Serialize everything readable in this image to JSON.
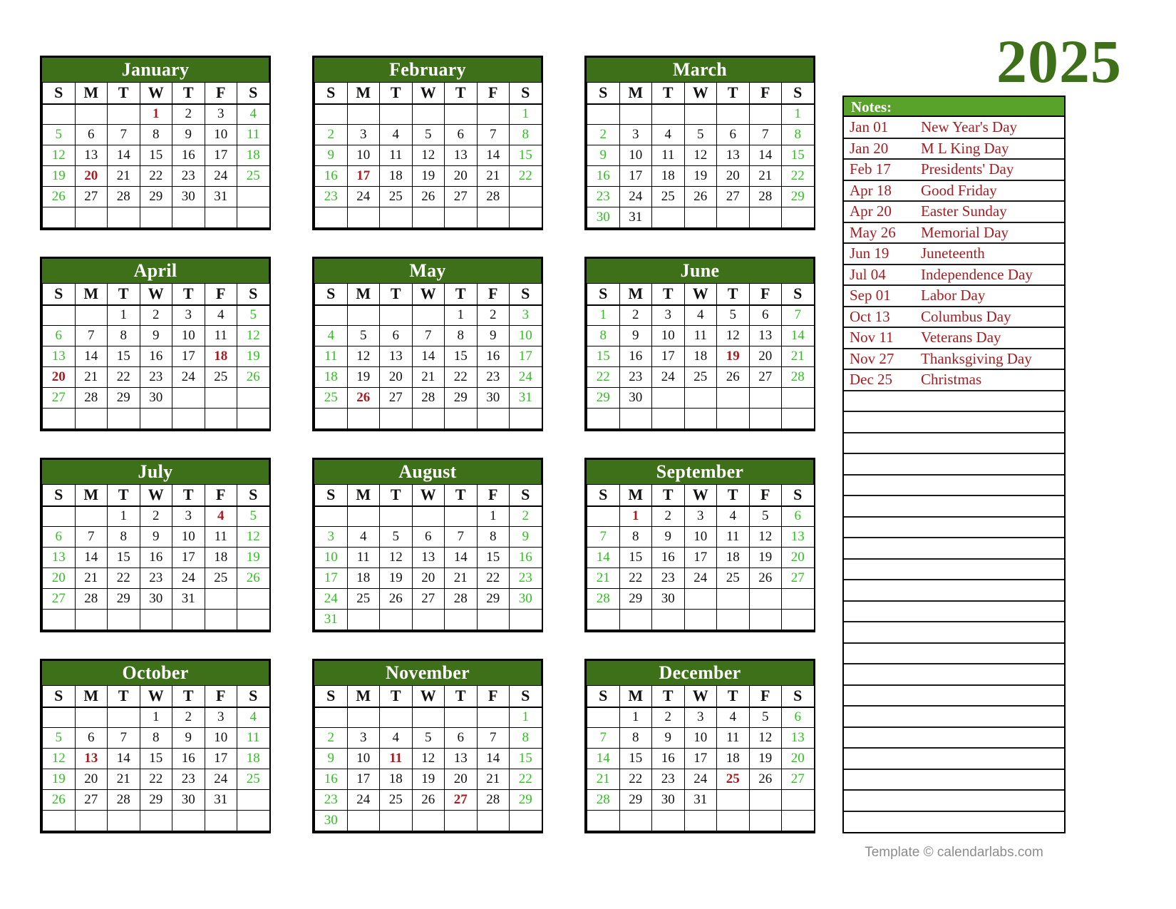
{
  "year_title": "2025",
  "colors": {
    "month_header_green": "#3d7019",
    "notes_header_green": "#5aa32a",
    "weekend_green": "#2fc21f",
    "holiday_red": "#a61c20",
    "footer_gray": "#8c8c8c"
  },
  "weekday_headers": [
    "S",
    "M",
    "T",
    "W",
    "T",
    "F",
    "S"
  ],
  "months": [
    {
      "name": "January",
      "weeks": [
        [
          "",
          "",
          "",
          "1",
          "2",
          "3",
          "4"
        ],
        [
          "5",
          "6",
          "7",
          "8",
          "9",
          "10",
          "11"
        ],
        [
          "12",
          "13",
          "14",
          "15",
          "16",
          "17",
          "18"
        ],
        [
          "19",
          "20",
          "21",
          "22",
          "23",
          "24",
          "25"
        ],
        [
          "26",
          "27",
          "28",
          "29",
          "30",
          "31",
          ""
        ],
        [
          "",
          "",
          "",
          "",
          "",
          "",
          ""
        ]
      ],
      "holidays": [
        "1",
        "20"
      ]
    },
    {
      "name": "February",
      "weeks": [
        [
          "",
          "",
          "",
          "",
          "",
          "",
          "1"
        ],
        [
          "2",
          "3",
          "4",
          "5",
          "6",
          "7",
          "8"
        ],
        [
          "9",
          "10",
          "11",
          "12",
          "13",
          "14",
          "15"
        ],
        [
          "16",
          "17",
          "18",
          "19",
          "20",
          "21",
          "22"
        ],
        [
          "23",
          "24",
          "25",
          "26",
          "27",
          "28",
          ""
        ],
        [
          "",
          "",
          "",
          "",
          "",
          "",
          ""
        ]
      ],
      "holidays": [
        "17"
      ]
    },
    {
      "name": "March",
      "weeks": [
        [
          "",
          "",
          "",
          "",
          "",
          "",
          "1"
        ],
        [
          "2",
          "3",
          "4",
          "5",
          "6",
          "7",
          "8"
        ],
        [
          "9",
          "10",
          "11",
          "12",
          "13",
          "14",
          "15"
        ],
        [
          "16",
          "17",
          "18",
          "19",
          "20",
          "21",
          "22"
        ],
        [
          "23",
          "24",
          "25",
          "26",
          "27",
          "28",
          "29"
        ],
        [
          "30",
          "31",
          "",
          "",
          "",
          "",
          ""
        ]
      ],
      "holidays": []
    },
    {
      "name": "April",
      "weeks": [
        [
          "",
          "",
          "1",
          "2",
          "3",
          "4",
          "5"
        ],
        [
          "6",
          "7",
          "8",
          "9",
          "10",
          "11",
          "12"
        ],
        [
          "13",
          "14",
          "15",
          "16",
          "17",
          "18",
          "19"
        ],
        [
          "20",
          "21",
          "22",
          "23",
          "24",
          "25",
          "26"
        ],
        [
          "27",
          "28",
          "29",
          "30",
          "",
          "",
          ""
        ],
        [
          "",
          "",
          "",
          "",
          "",
          "",
          ""
        ]
      ],
      "holidays": [
        "18",
        "20"
      ]
    },
    {
      "name": "May",
      "weeks": [
        [
          "",
          "",
          "",
          "",
          "1",
          "2",
          "3"
        ],
        [
          "4",
          "5",
          "6",
          "7",
          "8",
          "9",
          "10"
        ],
        [
          "11",
          "12",
          "13",
          "14",
          "15",
          "16",
          "17"
        ],
        [
          "18",
          "19",
          "20",
          "21",
          "22",
          "23",
          "24"
        ],
        [
          "25",
          "26",
          "27",
          "28",
          "29",
          "30",
          "31"
        ],
        [
          "",
          "",
          "",
          "",
          "",
          "",
          ""
        ]
      ],
      "holidays": [
        "26"
      ]
    },
    {
      "name": "June",
      "weeks": [
        [
          "1",
          "2",
          "3",
          "4",
          "5",
          "6",
          "7"
        ],
        [
          "8",
          "9",
          "10",
          "11",
          "12",
          "13",
          "14"
        ],
        [
          "15",
          "16",
          "17",
          "18",
          "19",
          "20",
          "21"
        ],
        [
          "22",
          "23",
          "24",
          "25",
          "26",
          "27",
          "28"
        ],
        [
          "29",
          "30",
          "",
          "",
          "",
          "",
          ""
        ],
        [
          "",
          "",
          "",
          "",
          "",
          "",
          ""
        ]
      ],
      "holidays": [
        "19"
      ]
    },
    {
      "name": "July",
      "weeks": [
        [
          "",
          "",
          "1",
          "2",
          "3",
          "4",
          "5"
        ],
        [
          "6",
          "7",
          "8",
          "9",
          "10",
          "11",
          "12"
        ],
        [
          "13",
          "14",
          "15",
          "16",
          "17",
          "18",
          "19"
        ],
        [
          "20",
          "21",
          "22",
          "23",
          "24",
          "25",
          "26"
        ],
        [
          "27",
          "28",
          "29",
          "30",
          "31",
          "",
          ""
        ],
        [
          "",
          "",
          "",
          "",
          "",
          "",
          ""
        ]
      ],
      "holidays": [
        "4"
      ]
    },
    {
      "name": "August",
      "weeks": [
        [
          "",
          "",
          "",
          "",
          "",
          "1",
          "2"
        ],
        [
          "3",
          "4",
          "5",
          "6",
          "7",
          "8",
          "9"
        ],
        [
          "10",
          "11",
          "12",
          "13",
          "14",
          "15",
          "16"
        ],
        [
          "17",
          "18",
          "19",
          "20",
          "21",
          "22",
          "23"
        ],
        [
          "24",
          "25",
          "26",
          "27",
          "28",
          "29",
          "30"
        ],
        [
          "31",
          "",
          "",
          "",
          "",
          "",
          ""
        ]
      ],
      "holidays": []
    },
    {
      "name": "September",
      "weeks": [
        [
          "",
          "1",
          "2",
          "3",
          "4",
          "5",
          "6"
        ],
        [
          "7",
          "8",
          "9",
          "10",
          "11",
          "12",
          "13"
        ],
        [
          "14",
          "15",
          "16",
          "17",
          "18",
          "19",
          "20"
        ],
        [
          "21",
          "22",
          "23",
          "24",
          "25",
          "26",
          "27"
        ],
        [
          "28",
          "29",
          "30",
          "",
          "",
          "",
          ""
        ],
        [
          "",
          "",
          "",
          "",
          "",
          "",
          ""
        ]
      ],
      "holidays": [
        "1"
      ]
    },
    {
      "name": "October",
      "weeks": [
        [
          "",
          "",
          "",
          "1",
          "2",
          "3",
          "4"
        ],
        [
          "5",
          "6",
          "7",
          "8",
          "9",
          "10",
          "11"
        ],
        [
          "12",
          "13",
          "14",
          "15",
          "16",
          "17",
          "18"
        ],
        [
          "19",
          "20",
          "21",
          "22",
          "23",
          "24",
          "25"
        ],
        [
          "26",
          "27",
          "28",
          "29",
          "30",
          "31",
          ""
        ],
        [
          "",
          "",
          "",
          "",
          "",
          "",
          ""
        ]
      ],
      "holidays": [
        "13"
      ]
    },
    {
      "name": "November",
      "weeks": [
        [
          "",
          "",
          "",
          "",
          "",
          "",
          "1"
        ],
        [
          "2",
          "3",
          "4",
          "5",
          "6",
          "7",
          "8"
        ],
        [
          "9",
          "10",
          "11",
          "12",
          "13",
          "14",
          "15"
        ],
        [
          "16",
          "17",
          "18",
          "19",
          "20",
          "21",
          "22"
        ],
        [
          "23",
          "24",
          "25",
          "26",
          "27",
          "28",
          "29"
        ],
        [
          "30",
          "",
          "",
          "",
          "",
          "",
          ""
        ]
      ],
      "holidays": [
        "11",
        "27"
      ]
    },
    {
      "name": "December",
      "weeks": [
        [
          "",
          "1",
          "2",
          "3",
          "4",
          "5",
          "6"
        ],
        [
          "7",
          "8",
          "9",
          "10",
          "11",
          "12",
          "13"
        ],
        [
          "14",
          "15",
          "16",
          "17",
          "18",
          "19",
          "20"
        ],
        [
          "21",
          "22",
          "23",
          "24",
          "25",
          "26",
          "27"
        ],
        [
          "28",
          "29",
          "30",
          "31",
          "",
          "",
          ""
        ],
        [
          "",
          "",
          "",
          "",
          "",
          "",
          ""
        ]
      ],
      "holidays": [
        "25"
      ]
    }
  ],
  "notes": {
    "header": "Notes:",
    "entries": [
      {
        "date": "Jan 01",
        "name": "New Year's Day"
      },
      {
        "date": "Jan 20",
        "name": "M L King Day"
      },
      {
        "date": "Feb 17",
        "name": "Presidents' Day"
      },
      {
        "date": "Apr 18",
        "name": "Good Friday"
      },
      {
        "date": "Apr 20",
        "name": "Easter Sunday"
      },
      {
        "date": "May 26",
        "name": "Memorial Day"
      },
      {
        "date": "Jun 19",
        "name": "Juneteenth"
      },
      {
        "date": "Jul 04",
        "name": "Independence Day"
      },
      {
        "date": "Sep 01",
        "name": "Labor Day"
      },
      {
        "date": "Oct 13",
        "name": "Columbus Day"
      },
      {
        "date": "Nov 11",
        "name": "Veterans Day"
      },
      {
        "date": "Nov 27",
        "name": "Thanksgiving Day"
      },
      {
        "date": "Dec 25",
        "name": "Christmas"
      }
    ],
    "blank_line_count": 21
  },
  "footer": {
    "credit": "Template © calendarlabs.com"
  }
}
